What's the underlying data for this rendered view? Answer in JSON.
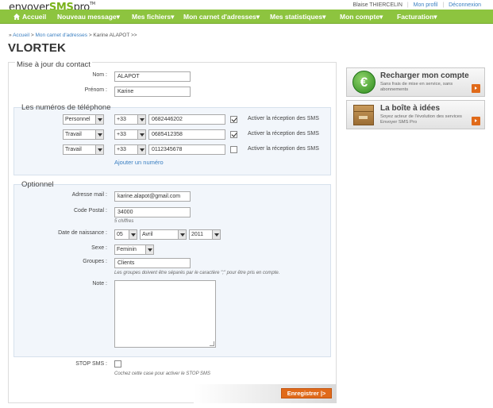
{
  "header": {
    "logo": {
      "part1": "envoyer",
      "part2": "SMS",
      "part3": "pro",
      "tm": "TM"
    },
    "user_name": "Blaise THIERCELIN",
    "profile_link": "Mon profil",
    "logout_link": "Déconnexion",
    "nav": [
      {
        "label": "Accueil"
      },
      {
        "label": "Nouveau message▾"
      },
      {
        "label": "Mes fichiers▾"
      },
      {
        "label": "Mon carnet d'adresses▾"
      },
      {
        "label": "Mes statistiques▾"
      },
      {
        "label": "Mon compte▾"
      },
      {
        "label": "Facturation▾"
      }
    ]
  },
  "breadcrumb": {
    "prefix": "» ",
    "home": "Accueil",
    "sep1": " > ",
    "book": "Mon carnet d'adresses",
    "current": " > Karine ALAPOT >>"
  },
  "page_title": "VLORTEK",
  "contact": {
    "legend": "Mise à jour du contact",
    "nom_label": "Nom :",
    "nom_value": "ALAPOT",
    "prenom_label": "Prénom :",
    "prenom_value": "Karine"
  },
  "phones": {
    "legend": "Les numéros de téléphone",
    "rows": [
      {
        "type": "Personnel",
        "code": "+33",
        "number": "0682446202",
        "sms_checked": true,
        "sms_label": "Activer la réception des SMS"
      },
      {
        "type": "Travail",
        "code": "+33",
        "number": "0685412358",
        "sms_checked": true,
        "sms_label": "Activer la réception des SMS"
      },
      {
        "type": "Travail",
        "code": "+33",
        "number": "0112345678",
        "sms_checked": false,
        "sms_label": "Activer la réception des SMS"
      }
    ],
    "add_link": "Ajouter un numéro"
  },
  "optional": {
    "legend": "Optionnel",
    "email_label": "Adresse mail :",
    "email_value": "karine.alapot@gmail.com",
    "postal_label": "Code Postal :",
    "postal_value": "34000",
    "postal_hint": "5 chiffres",
    "birth_label": "Date de naissance :",
    "birth_day": "05",
    "birth_month": "Avril",
    "birth_year": "2011",
    "sexe_label": "Sexe :",
    "sexe_value": "Feminin",
    "groups_label": "Groupes :",
    "groups_value": "Clients",
    "groups_hint": "Les groupes doivent être séparés par le caractère \";\" pour être pris en compte.",
    "note_label": "Note :"
  },
  "stop_sms": {
    "label": "STOP SMS :",
    "checked": false,
    "hint": "Cochez cette case pour activer le STOP SMS"
  },
  "save_button": "Enregistrer",
  "save_arrow": "|>",
  "sidebar": {
    "recharge": {
      "title": "Recharger mon compte",
      "desc": "Sans frais de mise en service, sans abonnements",
      "icon": "euro-icon",
      "glyph": "€"
    },
    "ideas": {
      "title": "La boîte à idées",
      "desc": "Soyez acteur de l'évolution des services Envoyer SMS Pro",
      "icon": "box-icon"
    }
  },
  "colors": {
    "nav_green": "#8dc43f",
    "accent_orange": "#e06a1a",
    "link_blue": "#3a7fc1"
  }
}
